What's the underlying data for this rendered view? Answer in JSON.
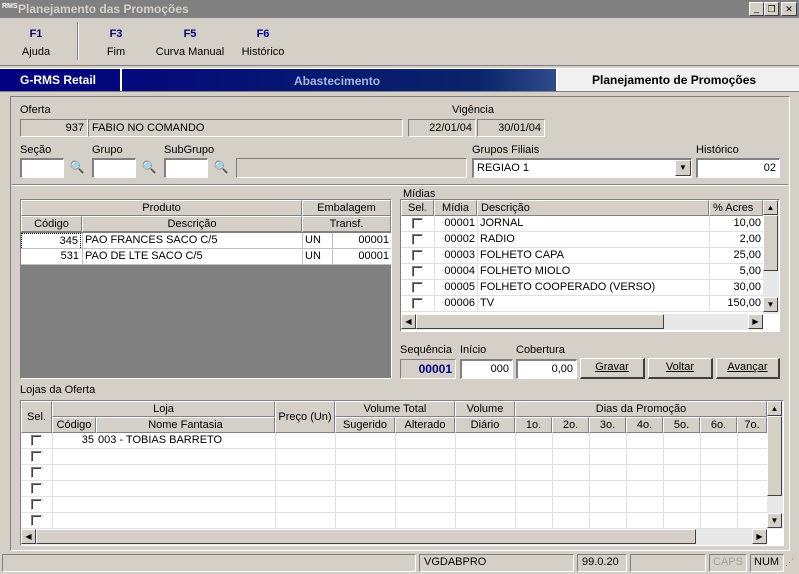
{
  "window": {
    "title": "Planejamento das Promoções",
    "min": "_",
    "max": "❐",
    "close": "✕",
    "app_icon": "RMS"
  },
  "toolbar": [
    {
      "key": "F1",
      "label": "Ajuda"
    },
    {
      "key": "F3",
      "label": "Fim"
    },
    {
      "key": "F5",
      "label": "Curva Manual"
    },
    {
      "key": "F6",
      "label": "Histórico"
    }
  ],
  "banner": {
    "brand": "G-RMS Retail",
    "module": "Abastecimento",
    "screen": "Planejamento de Promoções"
  },
  "oferta": {
    "label": "Oferta",
    "code": "937",
    "name": "FABIO NO COMANDO"
  },
  "vigencia": {
    "label": "Vigência",
    "start": "22/01/04",
    "end": "30/01/04"
  },
  "filters": {
    "secao": "Seção",
    "grupo": "Grupo",
    "subgrupo": "SubGrupo",
    "grupos_filiais": "Grupos Filiais",
    "grupos_filiais_value": "REGIAO 1",
    "historico": "Histórico",
    "historico_value": "02"
  },
  "produtos": {
    "headers": {
      "produto": "Produto",
      "embalagem": "Embalagem",
      "codigo": "Código",
      "descricao": "Descrição",
      "transf": "Transf."
    },
    "rows": [
      {
        "codigo": "345",
        "descricao": "PAO FRANCES SACO C/5",
        "un": "UN",
        "transf": "00001"
      },
      {
        "codigo": "531",
        "descricao": "PAO DE LTE SACO C/5",
        "un": "UN",
        "transf": "00001"
      }
    ]
  },
  "midias": {
    "label": "Mídias",
    "headers": {
      "sel": "Sel.",
      "midia": "Mídia",
      "descricao": "Descrição",
      "acres": "% Acres"
    },
    "rows": [
      {
        "midia": "00001",
        "descricao": "JORNAL",
        "acres": "10,00"
      },
      {
        "midia": "00002",
        "descricao": "RADIO",
        "acres": "2,00"
      },
      {
        "midia": "00003",
        "descricao": "FOLHETO CAPA",
        "acres": "25,00"
      },
      {
        "midia": "00004",
        "descricao": "FOLHETO MIOLO",
        "acres": "5,00"
      },
      {
        "midia": "00005",
        "descricao": "FOLHETO COOPERADO (VERSO)",
        "acres": "30,00"
      },
      {
        "midia": "00006",
        "descricao": "TV",
        "acres": "150,00"
      }
    ]
  },
  "sequencia": {
    "label": "Sequência",
    "value": "00001"
  },
  "inicio": {
    "label": "Início",
    "value": "000"
  },
  "cobertura": {
    "label": "Cobertura",
    "value": "0,00"
  },
  "buttons": {
    "gravar": "Gravar",
    "voltar": "Voltar",
    "avancar": "Avançar"
  },
  "lojas": {
    "label": "Lojas da Oferta",
    "headers": {
      "sel": "Sel.",
      "loja": "Loja",
      "codigo": "Código",
      "nome": "Nome Fantasia",
      "preco": "Preço (Un)",
      "volume_total": "Volume Total",
      "sugerido": "Sugerido",
      "alterado": "Alterado",
      "volume": "Volume",
      "diario": "Diário",
      "dias": "Dias da Promoção",
      "d1": "1o.",
      "d2": "2o.",
      "d3": "3o.",
      "d4": "4o.",
      "d5": "5o.",
      "d6": "6o.",
      "d7": "7o."
    },
    "rows": [
      {
        "codigo": "35",
        "nome": "003 - TOBIAS BARRETO"
      }
    ]
  },
  "status": {
    "user": "VGDABPRO",
    "version": "99.0.20",
    "caps": "CAPS",
    "num": "NUM"
  }
}
